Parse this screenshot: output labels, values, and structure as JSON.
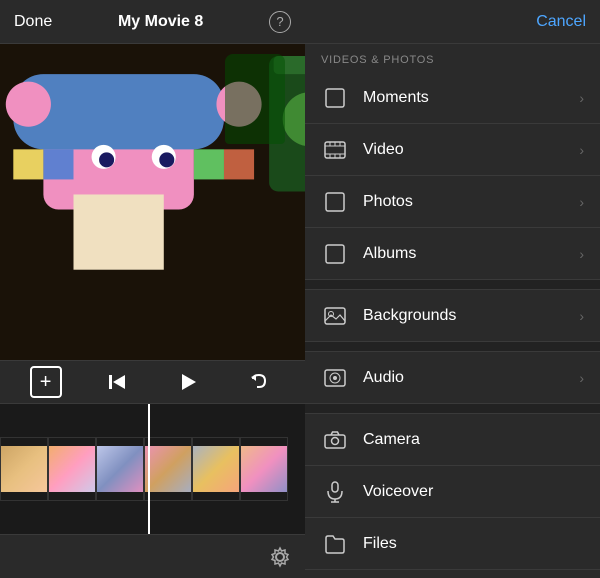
{
  "left": {
    "done_label": "Done",
    "title": "My Movie 8",
    "help_icon": "?",
    "controls": {
      "plus": "+",
      "skip_back": "⏮",
      "play": "▶",
      "undo": "↩"
    },
    "settings_icon": "⚙"
  },
  "right": {
    "cancel_label": "Cancel",
    "section_label": "VIDEOS & PHOTOS",
    "menu_items": [
      {
        "id": "moments",
        "label": "Moments",
        "icon": "square"
      },
      {
        "id": "video",
        "label": "Video",
        "icon": "film"
      },
      {
        "id": "photos",
        "label": "Photos",
        "icon": "square"
      },
      {
        "id": "albums",
        "label": "Albums",
        "icon": "square"
      }
    ],
    "menu_items2": [
      {
        "id": "backgrounds",
        "label": "Backgrounds",
        "icon": "image"
      },
      {
        "id": "audio",
        "label": "Audio",
        "icon": "music"
      },
      {
        "id": "camera",
        "label": "Camera",
        "icon": "camera"
      },
      {
        "id": "voiceover",
        "label": "Voiceover",
        "icon": "mic"
      },
      {
        "id": "files",
        "label": "Files",
        "icon": "folder"
      }
    ]
  }
}
